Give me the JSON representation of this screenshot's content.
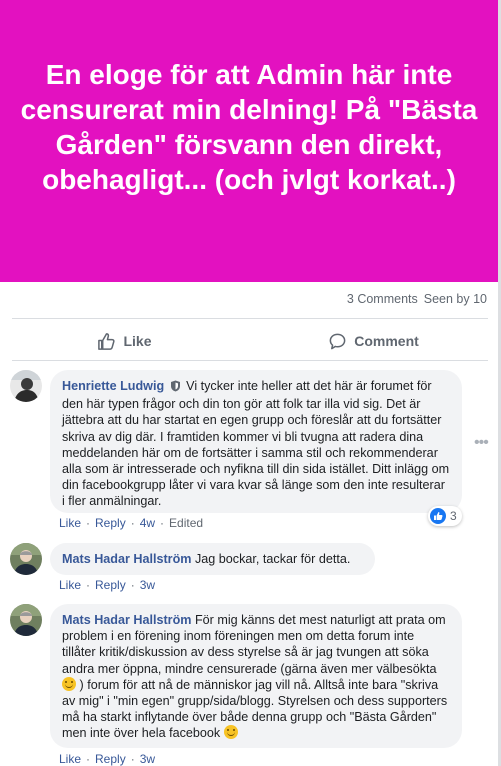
{
  "post": {
    "text": "En eloge för att Admin här inte censurerat min delning! På \"Bästa Gården\" försvann den direkt, obehagligt... (och jvlgt korkat..)",
    "comments_count": "3 Comments",
    "seen_by": "Seen by 10",
    "background_color": "#e311c0"
  },
  "actions": {
    "like": "Like",
    "comment": "Comment"
  },
  "comments": [
    {
      "author": "Henriette Ludwig",
      "text": "Vi tycker inte heller att det här är forumet för den här typen frågor och din ton gör att folk tar illa vid sig. Det är jättebra att du har startat en egen grupp och föreslår att du fortsätter skriva av dig där. I framtiden kommer vi bli tvugna att radera dina meddelanden här om de fortsätter i samma stil och rekommenderar alla som är intresserade och nyfikna till din sida istället. Ditt inlägg om din facebookgrupp låter vi vara kvar så länge som den inte resulterar i fler anmälningar.",
      "like": "Like",
      "reply": "Reply",
      "time": "4w",
      "edited": "Edited",
      "reactions": "3"
    },
    {
      "author": "Mats Hadar Hallström",
      "text": "Jag bockar, tackar för detta.",
      "like": "Like",
      "reply": "Reply",
      "time": "3w"
    },
    {
      "author": "Mats Hadar Hallström",
      "text_part1": "För mig känns det mest naturligt att prata om problem i en förening inom föreningen men om detta forum inte tillåter kritik/diskussion av dess styrelse så är jag tvungen att söka andra mer öppna, mindre censurerade (gärna även mer välbesökta",
      "text_part2": ") forum för att nå de människor jag vill nå. Alltså inte bara \"skriva av mig\" i \"min egen\" grupp/sida/blogg. Styrelsen och dess supporters må ha starkt inflytande över både denna grupp och \"Bästa Gården\" men inte över hela facebook",
      "like": "Like",
      "reply": "Reply",
      "time": "3w"
    }
  ]
}
